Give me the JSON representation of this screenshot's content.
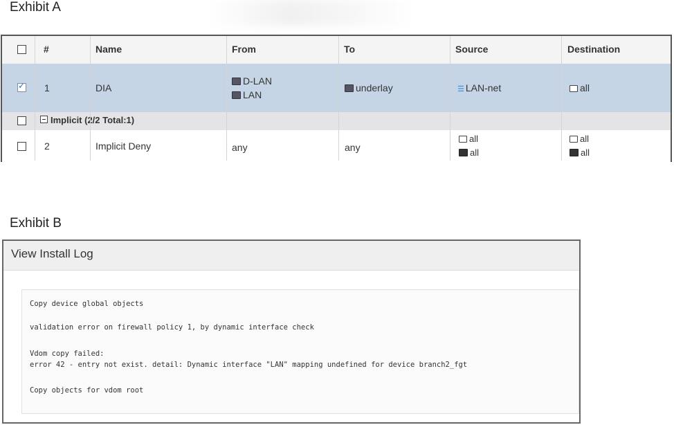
{
  "exhibit_a": {
    "label": "Exhibit A",
    "headers": {
      "number": "#",
      "name": "Name",
      "from": "From",
      "to": "To",
      "source": "Source",
      "destination": "Destination"
    },
    "rows": [
      {
        "number": "1",
        "name": "DIA",
        "checked": true,
        "from": [
          "D-LAN",
          "LAN"
        ],
        "to": "underlay",
        "source": "LAN-net",
        "destination": "all"
      }
    ],
    "group": {
      "label": "Implicit (2/2 Total:1)"
    },
    "implicit_row": {
      "number": "2",
      "name": "Implicit Deny",
      "checked": false,
      "from": "any",
      "to": "any",
      "source": [
        "all",
        "all"
      ],
      "destination": [
        "all",
        "all"
      ]
    }
  },
  "exhibit_b": {
    "label": "Exhibit B",
    "title": "View Install Log",
    "lines": [
      "Copy device global objects",
      "validation error on firewall policy 1, by dynamic interface check",
      "Vdom copy failed:",
      "error 42 - entry not exist. detail: Dynamic interface \"LAN\" mapping undefined for device branch2_fgt",
      "Copy objects for vdom root"
    ]
  }
}
